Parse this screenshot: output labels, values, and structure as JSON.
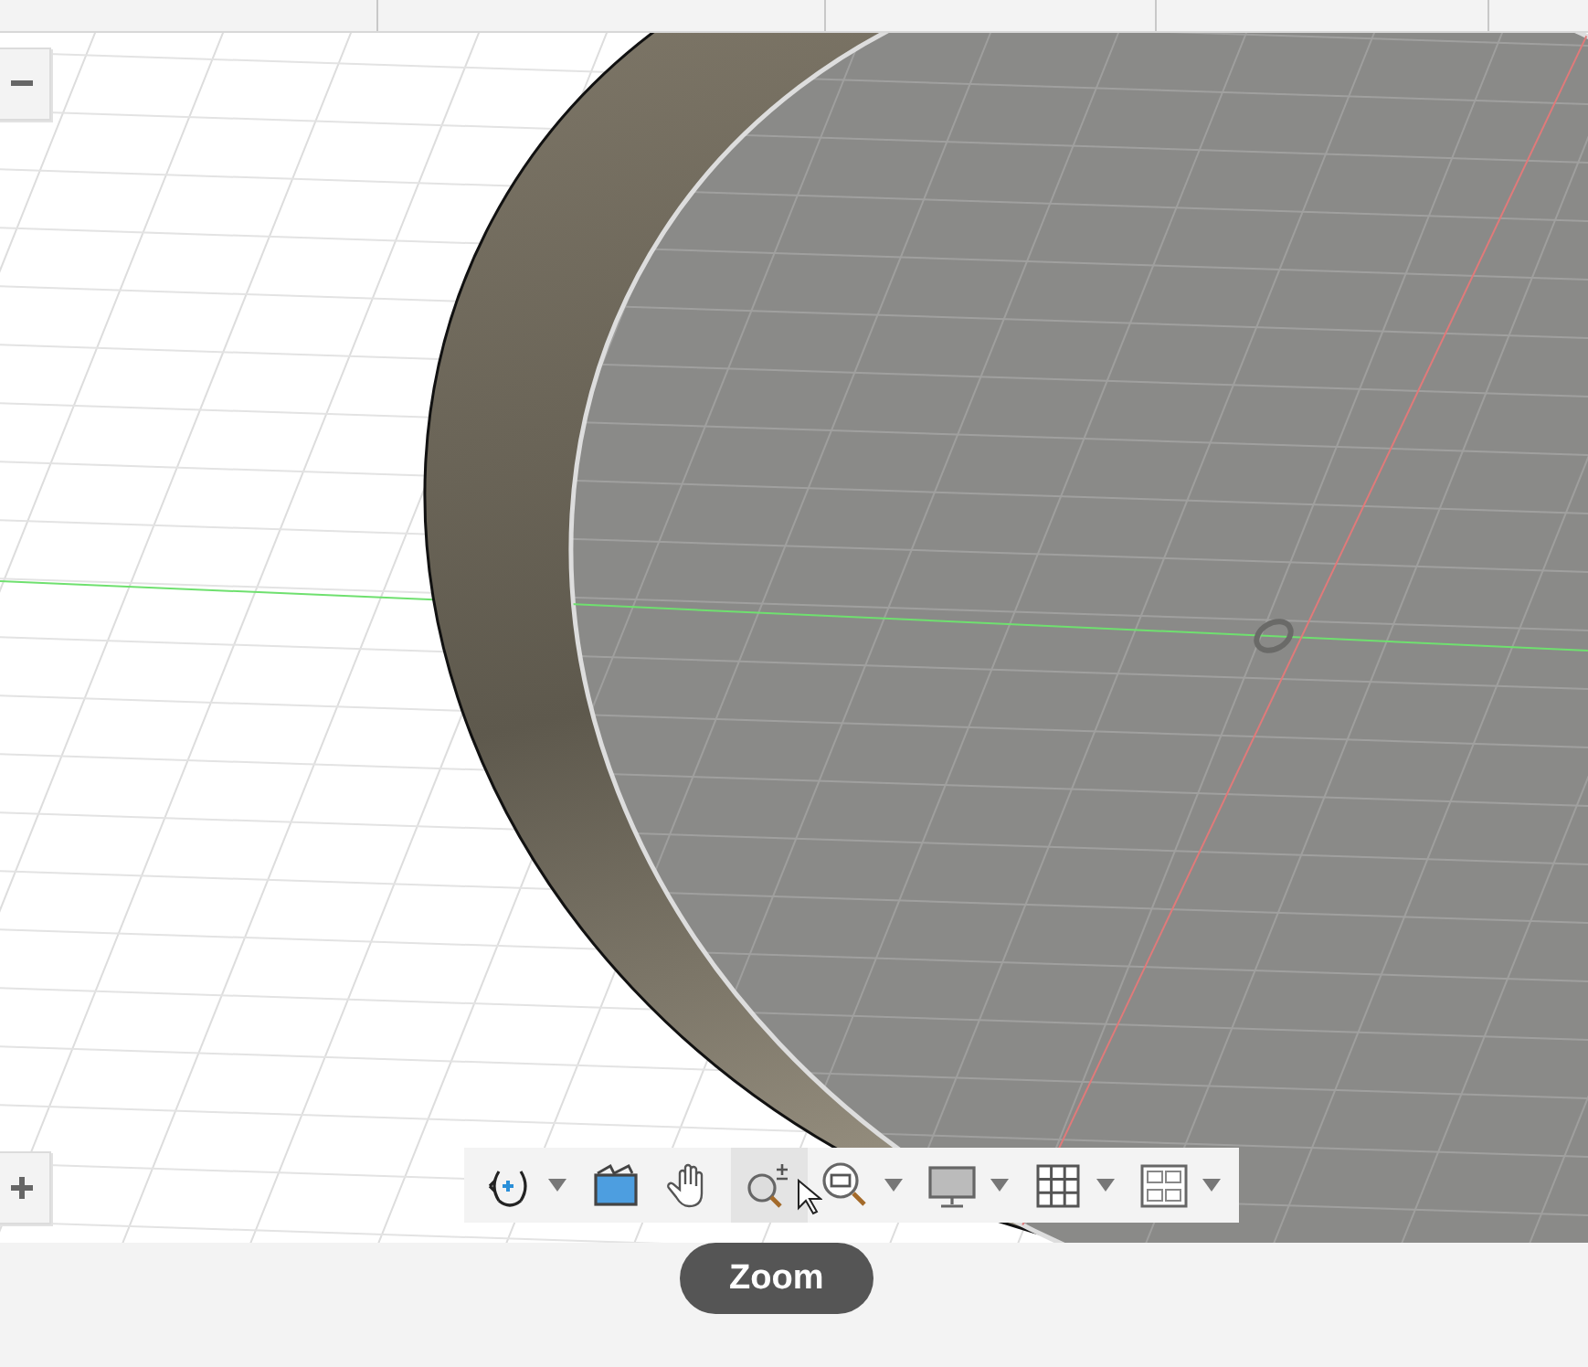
{
  "side_controls": [
    {
      "kind": "collapse"
    },
    {
      "kind": "expand"
    }
  ],
  "toolbar": {
    "items": [
      {
        "kind": "orbit",
        "dropdown": true,
        "selected": false
      },
      {
        "kind": "look-at",
        "dropdown": false,
        "selected": false
      },
      {
        "kind": "pan",
        "dropdown": false,
        "selected": false
      },
      {
        "kind": "zoom",
        "dropdown": false,
        "selected": true
      },
      {
        "kind": "fit",
        "dropdown": true,
        "selected": false
      },
      {
        "kind": "display",
        "dropdown": true,
        "selected": false
      },
      {
        "kind": "grid",
        "dropdown": true,
        "selected": false
      },
      {
        "kind": "viewports",
        "dropdown": true,
        "selected": false
      }
    ]
  },
  "tooltip": {
    "text": "Zoom"
  }
}
